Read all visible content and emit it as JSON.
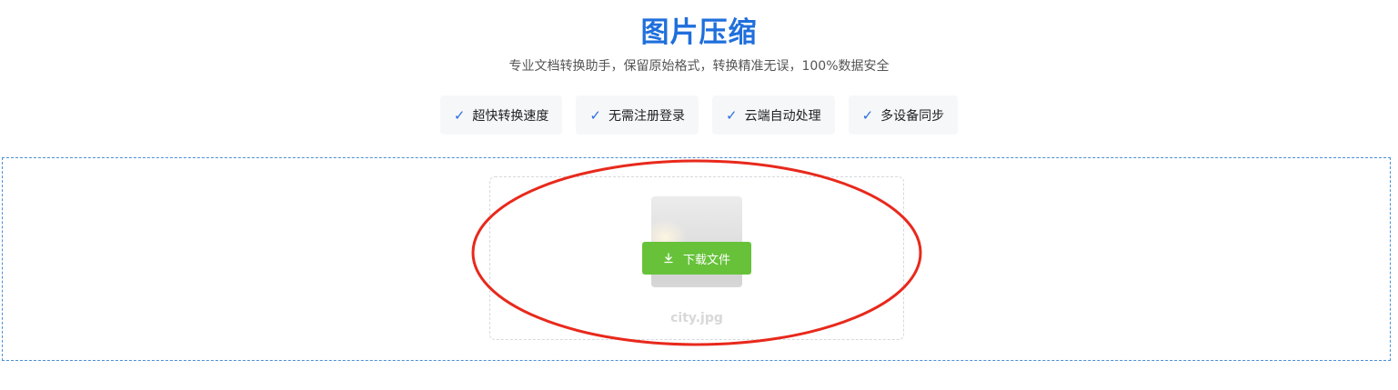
{
  "header": {
    "title": "图片压缩",
    "subtitle": "专业文档转换助手，保留原始格式，转换精准无误，100%数据安全"
  },
  "features": [
    {
      "icon": "check-icon",
      "label": "超快转换速度"
    },
    {
      "icon": "check-icon",
      "label": "无需注册登录"
    },
    {
      "icon": "check-icon",
      "label": "云端自动处理"
    },
    {
      "icon": "check-icon",
      "label": "多设备同步"
    }
  ],
  "upload": {
    "file": {
      "name": "city.jpg",
      "download_label": "下载文件",
      "download_icon": "download-icon"
    }
  },
  "colors": {
    "title": "#1f6fdc",
    "check": "#2a6fe0",
    "download_button": "#67c23a",
    "dropzone_border": "#4a8fd6",
    "annotation": "#e8291c"
  }
}
